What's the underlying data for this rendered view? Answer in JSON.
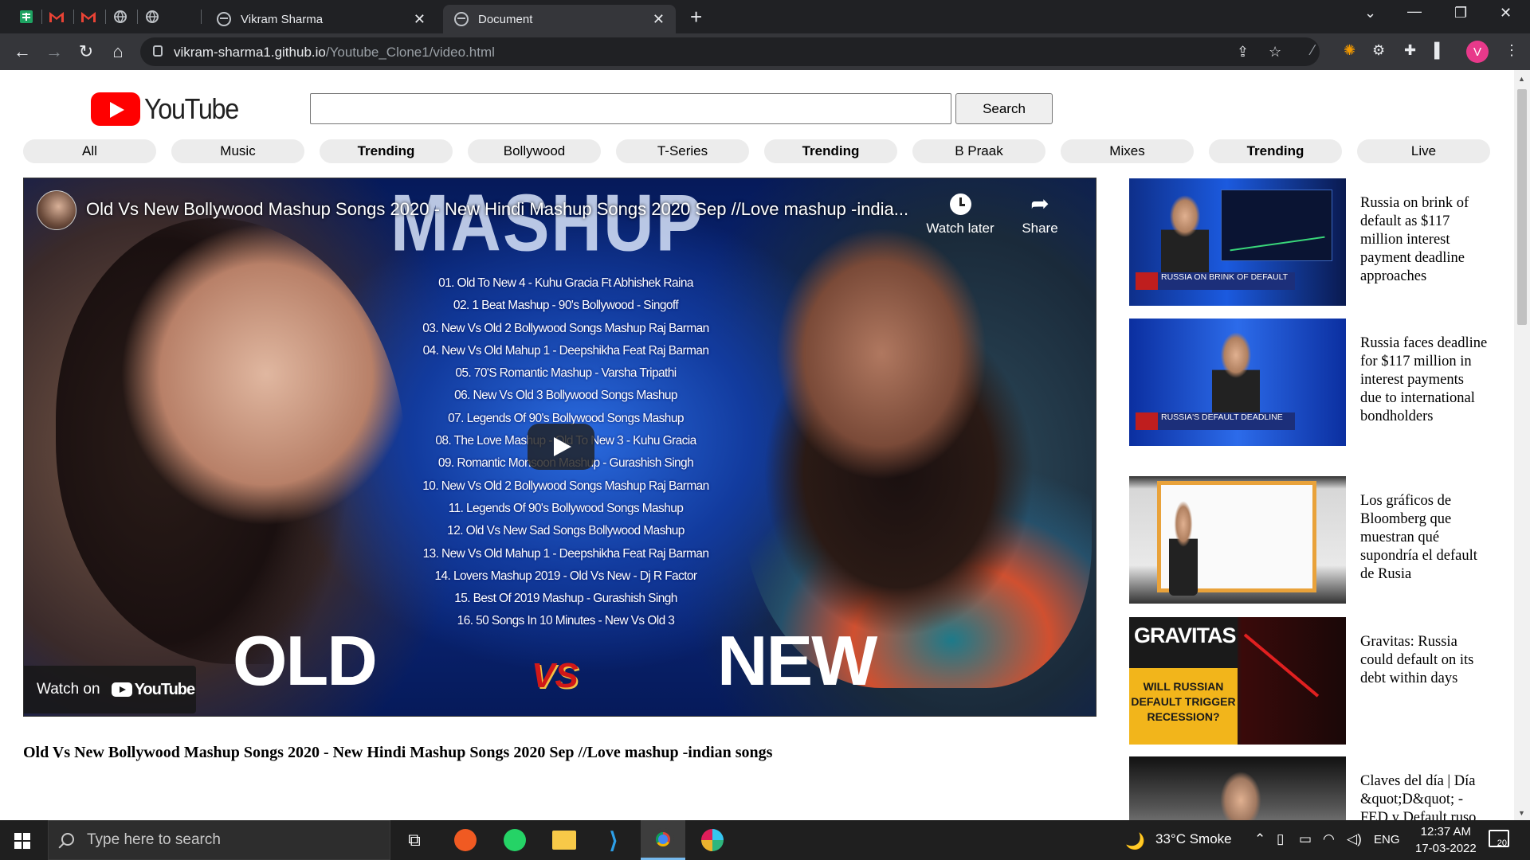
{
  "browser": {
    "tabs": [
      {
        "label": "Vikram Sharma",
        "active": false
      },
      {
        "label": "Document",
        "active": true
      }
    ],
    "pinned_tabs": [
      "google-sheets-icon",
      "gmail-icon",
      "gmail-icon",
      "globe-icon",
      "globe-icon"
    ],
    "url_host": "vikram-sharma1.github.io",
    "url_path": "/Youtube_Clone1/video.html",
    "profile_initial": "V"
  },
  "page": {
    "logo_text": "YouTube",
    "search": {
      "value": "",
      "button_label": "Search"
    },
    "chips": [
      "All",
      "Music",
      "Trending",
      "Bollywood",
      "T-Series",
      "Trending",
      "B Praak",
      "Mixes",
      "Trending",
      "Live"
    ],
    "player": {
      "overlay_title": "Old Vs New Bollywood Mashup Songs 2020 - New Hindi Mashup Songs 2020 Sep //Love mashup -india...",
      "watch_later": "Watch later",
      "share": "Share",
      "watch_on": "Watch on",
      "watch_on_brand": "YouTube",
      "thumb_heading": "MASHUP",
      "thumb_old": "OLD",
      "thumb_vs": "VS",
      "thumb_new": "NEW",
      "tracks": [
        "01. Old To New 4 - Kuhu Gracia Ft Abhishek Raina",
        "02. 1 Beat Mashup - 90's Bollywood - Singoff",
        "03. New Vs Old 2 Bollywood Songs Mashup Raj Barman",
        "04. New Vs Old Mahup 1 - Deepshikha Feat Raj Barman",
        "05. 70'S Romantic Mashup - Varsha Tripathi",
        "06. New Vs Old 3 Bollywood Songs Mashup",
        "07. Legends Of 90's Bollywood Songs Mashup",
        "08. The Love Mashup - Old To New 3 - Kuhu Gracia",
        "09. Romantic Monsoon Mashup - Gurashish Singh",
        "10. New Vs Old 2 Bollywood Songs Mashup Raj Barman",
        "11. Legends Of 90's Bollywood Songs Mashup",
        "12. Old Vs New Sad Songs Bollywood Mashup",
        "13. New Vs Old Mahup 1 - Deepshikha Feat Raj Barman",
        "14. Lovers Mashup 2019 - Old Vs New - Dj R Factor",
        "15. Best Of 2019 Mashup - Gurashish Singh",
        "16. 50 Songs In 10 Minutes - New Vs Old 3"
      ]
    },
    "video_title": "Old Vs New Bollywood Mashup Songs 2020 - New Hindi Mashup Songs 2020 Sep //Love mashup -indian songs",
    "related": [
      {
        "title": "Russia on brink of default as $117 million interest payment deadline approaches",
        "banner": "RUSSIA ON BRINK OF DEFAULT"
      },
      {
        "title": "Russia faces deadline for $117 million in interest payments due to international bondholders",
        "banner": "RUSSIA'S DEFAULT DEADLINE"
      },
      {
        "title": "Los gráficos de Bloomberg que muestran qué supondría el default de Rusia",
        "banner": ""
      },
      {
        "title": "Gravitas: Russia could default on its debt within days",
        "banner": "WILL RUSSIAN DEFAULT TRIGGER RECESSION?",
        "brand": "GRAVITAS"
      },
      {
        "title": "Claves del día | Día &quot;D&quot; - FED y Default ruso",
        "banner": ""
      }
    ]
  },
  "taskbar": {
    "search_placeholder": "Type here to search",
    "weather": "33°C  Smoke",
    "lang": "ENG",
    "time": "12:37 AM",
    "date": "17-03-2022",
    "notifications": "20"
  }
}
